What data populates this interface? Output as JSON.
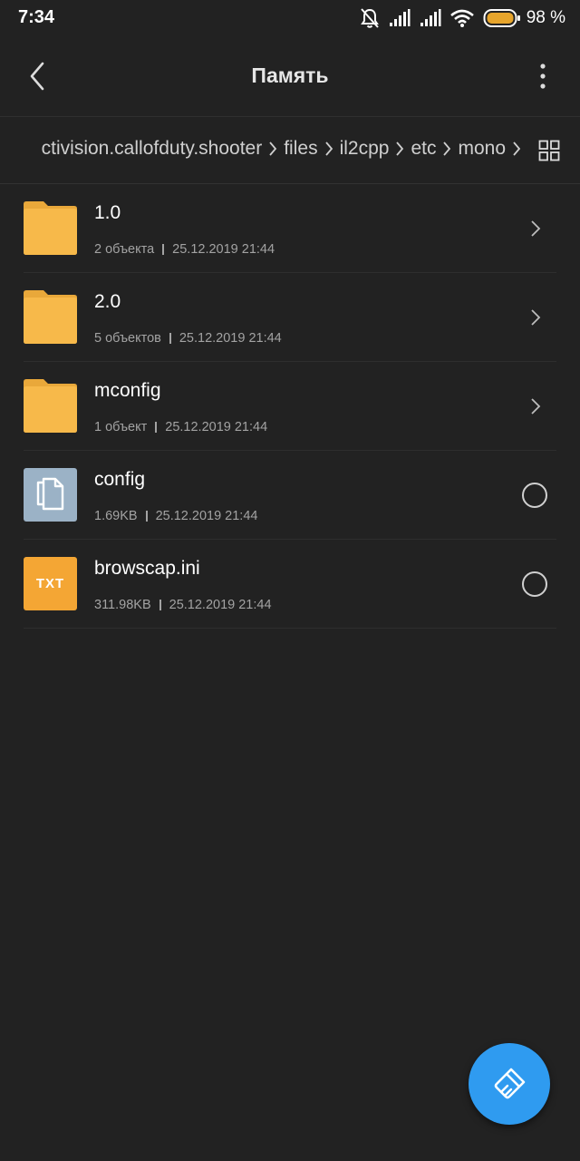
{
  "status_bar": {
    "time": "7:34",
    "battery_percent": "98 %",
    "icons": [
      "bell-off-icon",
      "signal-icon",
      "signal-icon",
      "wifi-icon",
      "battery-icon"
    ],
    "battery_color": "#e7a52c"
  },
  "header": {
    "title": "Память",
    "back_icon": "chevron-left-icon",
    "menu_icon": "more-vertical-icon"
  },
  "breadcrumb": {
    "items": [
      "ctivision.callofduty.shooter",
      "files",
      "il2cpp",
      "etc",
      "mono"
    ],
    "view_toggle_icon": "grid-icon"
  },
  "files": [
    {
      "name": "1.0",
      "count": "2 объекта",
      "date": "25.12.2019 21:44",
      "type": "folder"
    },
    {
      "name": "2.0",
      "count": "5 объектов",
      "date": "25.12.2019 21:44",
      "type": "folder"
    },
    {
      "name": "mconfig",
      "count": "1 объект",
      "date": "25.12.2019 21:44",
      "type": "folder"
    },
    {
      "name": "config",
      "count": "1.69KB",
      "date": "25.12.2019 21:44",
      "type": "file"
    },
    {
      "name": "browscap.ini",
      "count": "311.98KB",
      "date": "25.12.2019 21:44",
      "type": "txt",
      "badge": "TXT"
    }
  ],
  "colors": {
    "background": "#222222",
    "folder": "#f7b94a",
    "folder_dark": "#e9a83a",
    "file_icon_bg": "#9bb2c6",
    "txt_icon_bg": "#f4a634",
    "fab": "#2f9bf0"
  },
  "fab": {
    "icon": "brush-icon"
  }
}
